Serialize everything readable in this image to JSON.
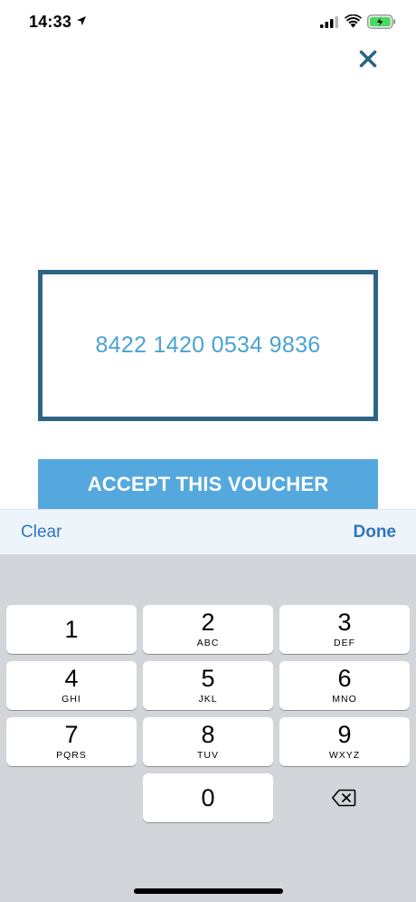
{
  "status_bar": {
    "time": "14:33",
    "icons": [
      "location-arrow-icon",
      "cellular-signal-icon",
      "wifi-icon",
      "battery-charging-icon"
    ],
    "battery_color": "#4cd964"
  },
  "close": {
    "icon": "close-icon",
    "color": "#2e6585"
  },
  "voucher": {
    "value": "8422 1420 0534 9836",
    "border_color": "#2e6585",
    "text_color": "#4aa3d2"
  },
  "accept_button": {
    "label": "ACCEPT THIS VOUCHER",
    "color": "#55a8de"
  },
  "keyboard_toolbar": {
    "clear_label": "Clear",
    "done_label": "Done",
    "accent": "#2f74c0"
  },
  "keypad": {
    "keys": [
      {
        "num": "1",
        "letters": ""
      },
      {
        "num": "2",
        "letters": "ABC"
      },
      {
        "num": "3",
        "letters": "DEF"
      },
      {
        "num": "4",
        "letters": "GHI"
      },
      {
        "num": "5",
        "letters": "JKL"
      },
      {
        "num": "6",
        "letters": "MNO"
      },
      {
        "num": "7",
        "letters": "PQRS"
      },
      {
        "num": "8",
        "letters": "TUV"
      },
      {
        "num": "9",
        "letters": "WXYZ"
      },
      {
        "num": "0",
        "letters": ""
      }
    ],
    "delete_icon": "backspace-icon"
  }
}
